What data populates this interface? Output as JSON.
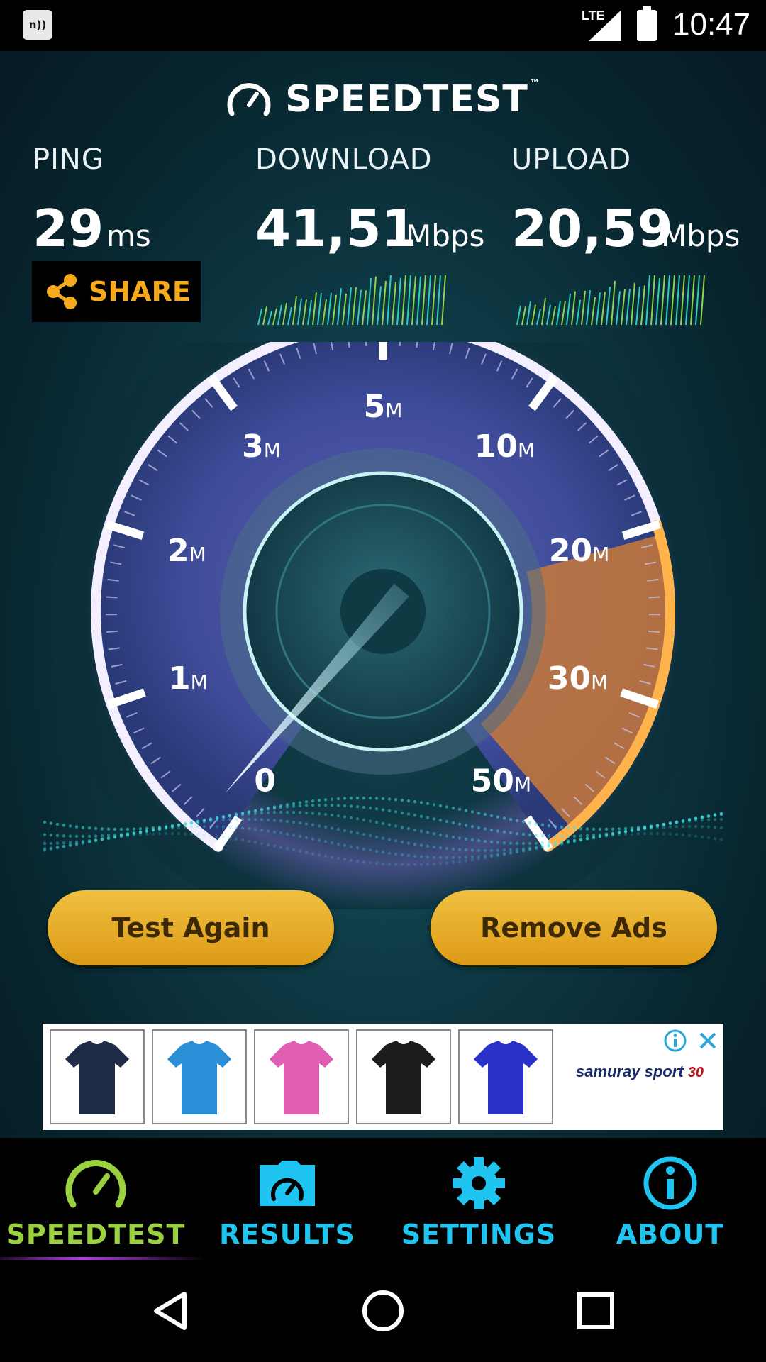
{
  "status_bar": {
    "nfc_label": "n))",
    "network": "LTE",
    "time": "10:47"
  },
  "header": {
    "title": "SPEEDTEST",
    "trademark": "™"
  },
  "metrics": {
    "ping": {
      "label": "PING",
      "value": "29",
      "unit": "ms"
    },
    "download": {
      "label": "DOWNLOAD",
      "value": "41,51",
      "unit": "Mbps"
    },
    "upload": {
      "label": "UPLOAD",
      "value": "20,59",
      "unit": "Mbps"
    }
  },
  "share": {
    "label": "SHARE"
  },
  "gauge": {
    "ticks": [
      {
        "num": "0",
        "unit": ""
      },
      {
        "num": "1",
        "unit": "M"
      },
      {
        "num": "2",
        "unit": "M"
      },
      {
        "num": "3",
        "unit": "M"
      },
      {
        "num": "5",
        "unit": "M"
      },
      {
        "num": "10",
        "unit": "M"
      },
      {
        "num": "20",
        "unit": "M"
      },
      {
        "num": "30",
        "unit": "M"
      },
      {
        "num": "50",
        "unit": "M"
      }
    ]
  },
  "actions": {
    "test_again": "Test Again",
    "remove_ads": "Remove Ads"
  },
  "ad": {
    "brand": "samuray sport",
    "brand_badge": "30",
    "products": [
      "navy-tshirt",
      "blue-tshirt",
      "pink-tshirt",
      "black-tshirt",
      "purple-tshirt"
    ],
    "product_colors": [
      "#1f2a44",
      "#2a8fd6",
      "#e05fb4",
      "#1c1c1c",
      "#2a30c8"
    ]
  },
  "tabs": [
    {
      "label": "SPEEDTEST",
      "icon": "gauge-icon",
      "color": "#9bd13f",
      "active": true
    },
    {
      "label": "RESULTS",
      "icon": "folder-gauge-icon",
      "color": "#20c4f0",
      "active": false
    },
    {
      "label": "SETTINGS",
      "icon": "gear-icon",
      "color": "#20c4f0",
      "active": false
    },
    {
      "label": "ABOUT",
      "icon": "info-icon",
      "color": "#20c4f0",
      "active": false
    }
  ],
  "colors": {
    "accent_orange": "#f7a91c",
    "button_gold": "#e6aa22",
    "tab_active_green": "#9bd13f",
    "tab_cyan": "#20c4f0"
  }
}
